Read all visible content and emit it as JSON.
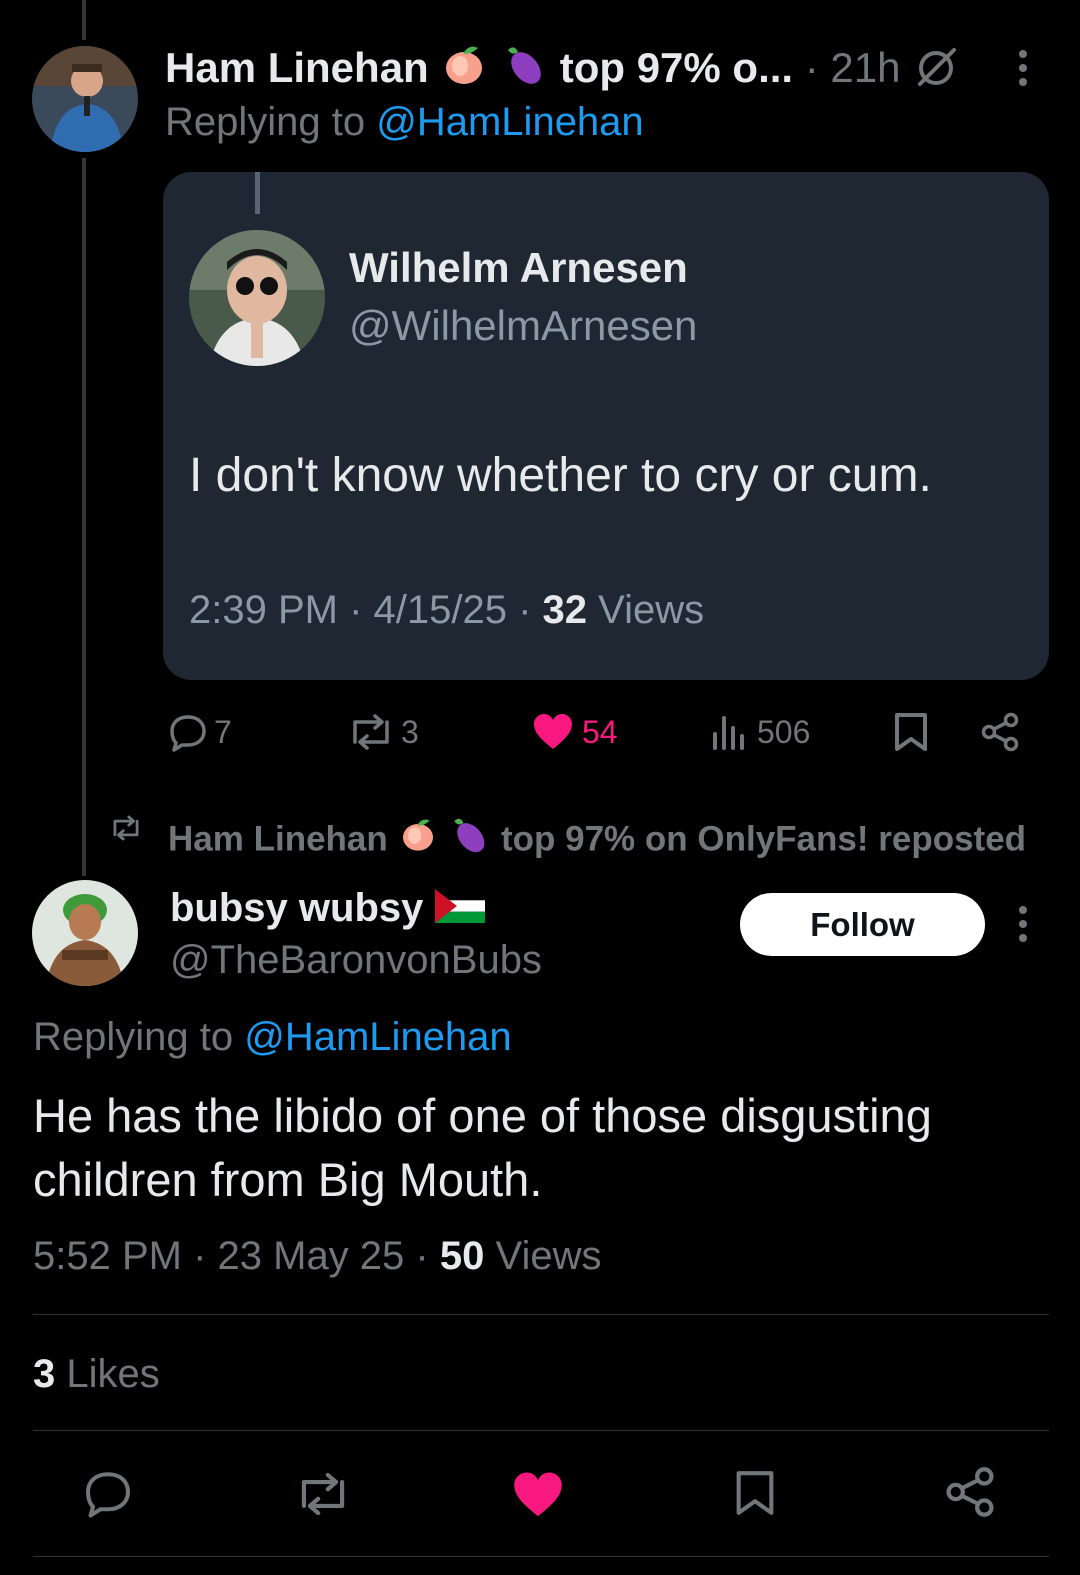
{
  "top_reply": {
    "author_name": "Ham Linehan",
    "author_suffix": "top 97% o...",
    "time": "· 21h",
    "replying_prefix": "Replying to",
    "replying_handle": "@HamLinehan"
  },
  "quote": {
    "name": "Wilhelm Arnesen",
    "handle": "@WilhelmArnesen",
    "text": "I don't know whether to cry or cum.",
    "timestamp": "2:39 PM · 4/15/25 ·",
    "views_count": "32",
    "views_label": "Views"
  },
  "top_actions": {
    "replies": "7",
    "reposts": "3",
    "likes": "54",
    "views": "506"
  },
  "repost_banner": {
    "name": "Ham Linehan",
    "suffix": "top 97% on OnlyFans! reposted"
  },
  "main_post": {
    "name": "bubsy wubsy",
    "handle": "@TheBaronvonBubs",
    "follow_label": "Follow",
    "replying_prefix": "Replying to",
    "replying_handle": "@HamLinehan",
    "text_line1": "He has the libido of one of those disgusting",
    "text_line2": "children from Big Mouth.",
    "timestamp": "5:52 PM · 23 May 25 ·",
    "views_count": "50",
    "views_label": "Views",
    "likes_count": "3",
    "likes_label": "Likes"
  },
  "icons": {
    "reply": "reply-icon",
    "repost": "repost-icon",
    "like": "heart-icon",
    "views": "views-icon",
    "bookmark": "bookmark-icon",
    "share": "share-icon",
    "more": "more-icon",
    "grok": "grok-icon"
  },
  "colors": {
    "background": "#000000",
    "card": "#1e2732",
    "link": "#1d9bf0",
    "like": "#f91880",
    "muted": "#71767b",
    "text": "#e7e9ea"
  }
}
